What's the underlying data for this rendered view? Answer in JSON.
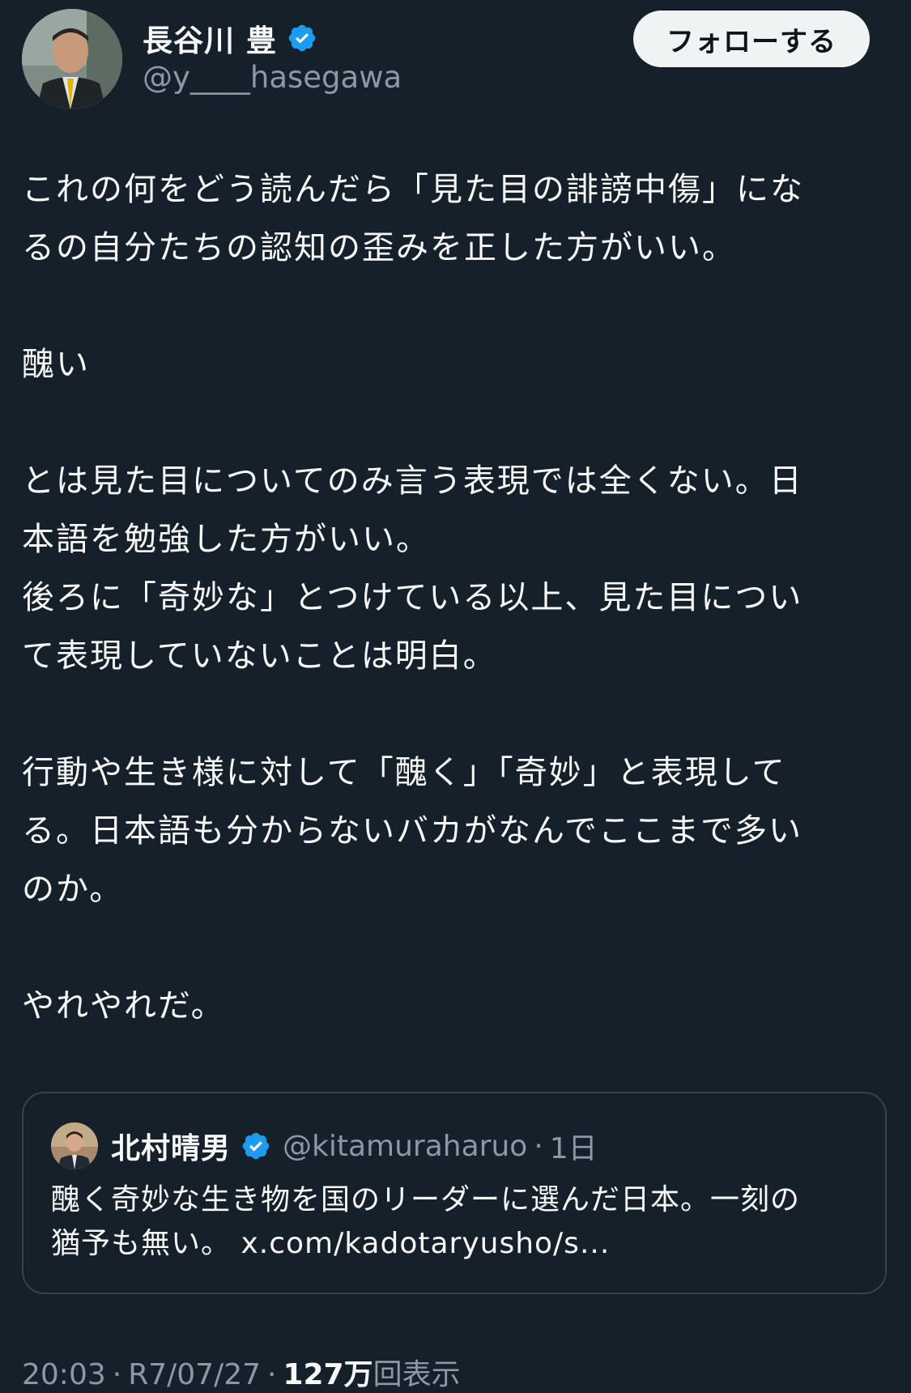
{
  "author": {
    "display_name": "長谷川 豊",
    "handle": "@y____hasegawa",
    "verified_icon": "verified-badge-icon",
    "avatar": "profile-photo"
  },
  "follow_button": {
    "label": "フォローする"
  },
  "tweet": {
    "lines": [
      "これの何をどう読んだら「見た目の誹謗中傷」にな",
      "るの自分たちの認知の歪みを正した方がいい。",
      "",
      "醜い",
      "",
      "とは見た目についてのみ言う表現では全くない。日",
      "本語を勉強した方がいい。",
      "後ろに「奇妙な」とつけている以上、見た目につい",
      "て表現していないことは明白。",
      "",
      "行動や生き様に対して「醜く」「奇妙」と表現して",
      "る。日本語も分からないバカがなんでここまで多い",
      "のか。",
      "",
      "やれやれだ。"
    ]
  },
  "quote": {
    "display_name": "北村晴男",
    "handle": "@kitamuraharuo",
    "separator": "·",
    "time": "1日",
    "lines": [
      "醜く奇妙な生き物を国のリーダーに選んだ日本。一刻の",
      "猶予も無い。 x.com/kadotaryusho/s..."
    ]
  },
  "meta": {
    "time": "20:03",
    "sep1": "·",
    "date": "R7/07/27",
    "sep2": "·",
    "views_count": "127万",
    "views_label": "回表示"
  },
  "colors": {
    "background": "#15202b",
    "text": "#f7f9f9",
    "secondary": "#8b98a5",
    "verified": "#1d9bf0",
    "border": "#38444d"
  }
}
